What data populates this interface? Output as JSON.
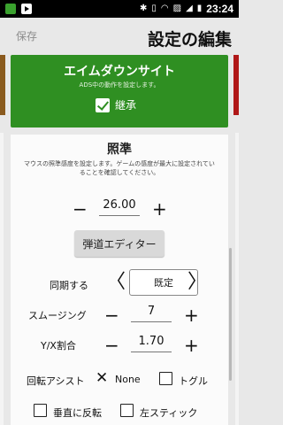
{
  "status_bar": {
    "time": "23:24"
  },
  "header": {
    "save_label": "保存",
    "title": "設定の編集"
  },
  "aim_down_sight": {
    "title": "エイムダウンサイト",
    "description": "ADS中の動作を設定します。",
    "inherit_label": "継承",
    "inherit_checked": true
  },
  "sensitivity": {
    "title": "照準",
    "description": "マウスの照準感度を設定します。ゲームの感度が最大に設定されていることを確認してください。",
    "value": "26.00",
    "minus": "−",
    "plus": "+"
  },
  "ballistics_editor": {
    "label": "弾道エディター"
  },
  "sync": {
    "label": "同期する",
    "value": "既定",
    "prev": "〈",
    "next": "〉"
  },
  "smoothing": {
    "label": "スムージング",
    "value": "7",
    "minus": "−",
    "plus": "+"
  },
  "yx_ratio": {
    "label": "Y/X割合",
    "value": "1.70",
    "minus": "−",
    "plus": "+"
  },
  "rotation_assist": {
    "label": "回転アシスト",
    "value": "None",
    "toggle_label": "トグル",
    "x_mark": "✕"
  },
  "options": {
    "invert_vertical": "垂直に反転",
    "left_stick": "左スティック"
  },
  "colors": {
    "accent_green": "#2f8f22",
    "card_bg": "#fbfbfb",
    "page_bg": "#e8e8e8"
  }
}
